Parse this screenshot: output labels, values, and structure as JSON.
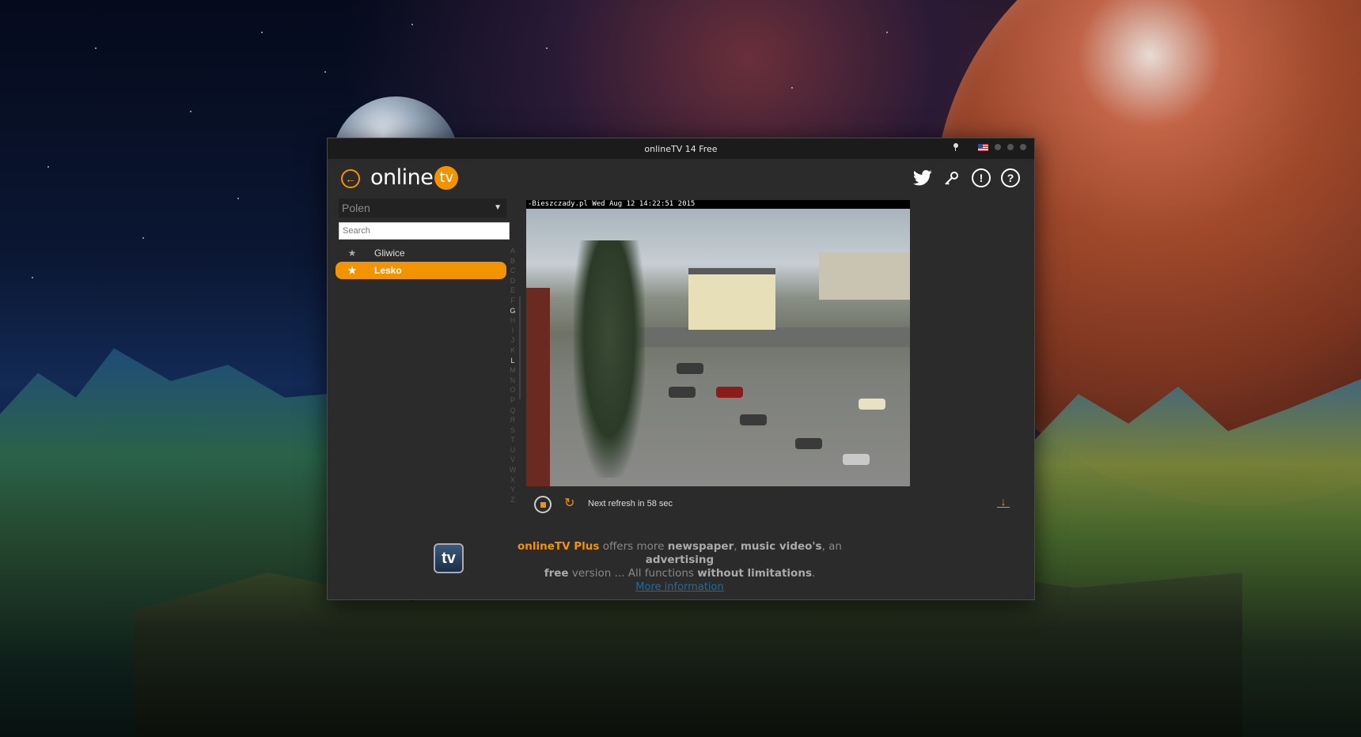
{
  "window": {
    "title": "onlineTV 14 Free"
  },
  "header": {
    "logo_text": "online",
    "logo_badge": "tv"
  },
  "sidebar": {
    "country": "Polen",
    "search_placeholder": "Search",
    "cities": [
      {
        "label": "Gliwice",
        "selected": false
      },
      {
        "label": "Lesko",
        "selected": true
      }
    ],
    "alphabet": [
      "A",
      "B",
      "C",
      "D",
      "E",
      "F",
      "G",
      "H",
      "I",
      "J",
      "K",
      "L",
      "M",
      "N",
      "O",
      "P",
      "Q",
      "R",
      "S",
      "T",
      "U",
      "V",
      "W",
      "X",
      "Y",
      "Z"
    ],
    "alphabet_active": [
      "G",
      "L"
    ]
  },
  "video": {
    "timestamp": "-Bieszczady.pl Wed Aug 12 14:22:51 2015"
  },
  "controls": {
    "refresh_text": "Next refresh in 58 sec"
  },
  "promo": {
    "logo": "tv",
    "brand": "onlineTV Plus",
    "t1": " offers more ",
    "b1": "newspaper",
    "t2": ", ",
    "b2": "music video's",
    "t3": ", an ",
    "b3": "advertising",
    "b4": "free",
    "t4": " version ... All functions ",
    "b5": "without limitations",
    "t5": ".",
    "link": "More information"
  },
  "colors": {
    "accent": "#f29400",
    "window_bg": "#2b2b2b",
    "titlebar_bg": "#1b1b1b"
  }
}
